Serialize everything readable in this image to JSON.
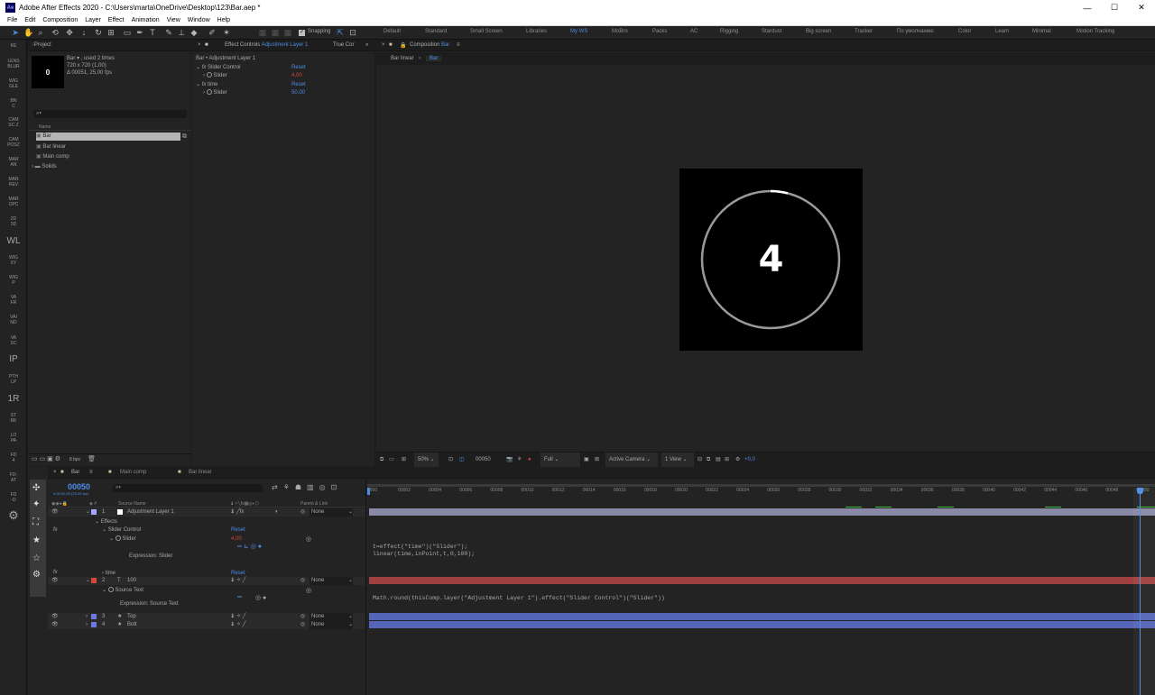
{
  "window": {
    "title": "Adobe After Effects 2020 - C:\\Users\\marta\\OneDrive\\Desktop\\123\\Bar.aep *",
    "logo": "Ae",
    "min": "—",
    "max": "☐",
    "close": "✕"
  },
  "menu": [
    "File",
    "Edit",
    "Composition",
    "Layer",
    "Effect",
    "Animation",
    "View",
    "Window",
    "Help"
  ],
  "toolbar": {
    "snapping_label": "Snapping",
    "workspaces": [
      "Default",
      "Standard",
      "Small Screen",
      "Libraries",
      "My WS",
      "MoBro",
      "Packs",
      "AC",
      "Rigging",
      "Stardust",
      "Big screen",
      "Tracker",
      "По умолчанию",
      "Color",
      "Learn",
      "Minimal",
      "Motion Tracking"
    ],
    "active_workspace": "My WS"
  },
  "leftbar": [
    "KE",
    "LENS\nBLUR",
    "WIG\nGLE",
    "BN\nC",
    "CAM\nSC Z",
    "CAM\nPOSZ",
    "MAR\nAN",
    "MAR\nREV",
    "MAR\nOPC",
    "2D\n3D",
    "WL",
    "WIG\nXY",
    "WIG\nP",
    "VA\nFR",
    "VAI\nND",
    "VA\nSC",
    "IP",
    "PTH\nLP",
    "1R",
    "ST\nRK",
    "LO\nPA",
    "FD\n4",
    "FD-\nAT",
    "FD\n-D"
  ],
  "project": {
    "tab": "Project",
    "thumb_value": "0",
    "selected_name": "Bar",
    "used": ", used 2 times",
    "dims": "720 x 720 (1,00)",
    "duration": "Δ 00051, 25,00 fps",
    "column_name": "Name",
    "items": [
      {
        "name": "Bar",
        "selected": true
      },
      {
        "name": "Bar linear",
        "selected": false
      },
      {
        "name": "Main comp",
        "selected": false
      },
      {
        "name": "Solids",
        "selected": false,
        "folder": true
      }
    ],
    "bpc": "8 bpc"
  },
  "effect_controls": {
    "tab_label": "Effect Controls",
    "tab_layer": "Adjustment Layer 1",
    "tab2": "True Cor",
    "header": "Bar • Adjustment Layer 1",
    "rows": [
      {
        "label": "Slider Control",
        "reset": "Reset"
      },
      {
        "label": "Slider",
        "value": "4,00"
      },
      {
        "label": "time",
        "reset": "Reset"
      },
      {
        "label": "Slider",
        "value": "50,00"
      }
    ]
  },
  "composition": {
    "tab_label": "Composition",
    "tab_name": "Bar",
    "crumb1": "Bar linear",
    "crumb2": "Bar",
    "display_number": "4",
    "progress": 0.04,
    "footer": {
      "zoom": "50%",
      "timecode": "00050",
      "resolution": "Full",
      "camera": "Active Camera",
      "view": "1 View",
      "exposure": "+0,0"
    }
  },
  "timeline": {
    "tabs": [
      "Bar",
      "Main comp",
      "Bar linear"
    ],
    "tab_colors": [
      "#d6c6a0",
      "#d6c6a0",
      "#d6c6a0"
    ],
    "timecode": "00050",
    "timecode_sub": "0:00:02:00 (25.00 fps)",
    "col_source": "Source Name",
    "col_parent": "Parent & Link",
    "ruler": [
      "0000",
      "00002",
      "00004",
      "00006",
      "00008",
      "00010",
      "00012",
      "00014",
      "00016",
      "00018",
      "00020",
      "00022",
      "00024",
      "00026",
      "00028",
      "00030",
      "00032",
      "00034",
      "00036",
      "00038",
      "00040",
      "00042",
      "00044",
      "00046",
      "00048",
      "00050"
    ],
    "layers": [
      {
        "num": "1",
        "name": "Adjustment Layer 1",
        "color": "#a6a6ff",
        "parent": "None"
      },
      {
        "num": "2",
        "name": "100",
        "color": "#d9443d",
        "parent": "None"
      },
      {
        "num": "3",
        "name": "Top",
        "color": "#6b79e0",
        "parent": "None"
      },
      {
        "num": "4",
        "name": "Bott",
        "color": "#6b79e0",
        "parent": "None"
      }
    ],
    "effects_label": "Effects",
    "slider_control_label": "Slider Control",
    "slider_label": "Slider",
    "slider_value": "4,00",
    "expression_slider": "Expression: Slider",
    "time_label": "time",
    "source_text_label": "Source Text",
    "expression_source_text": "Expression: Source Text",
    "reset": "Reset",
    "expr_code1": "t=effect(\"time\")(\"Slider\");",
    "expr_code2": "linear(time,inPoint,t,0,100);",
    "expr_code3": "Math.round(thisComp.layer(\"Adjustment Layer 1\").effect(\"Slider Control\")(\"Slider\"))"
  }
}
